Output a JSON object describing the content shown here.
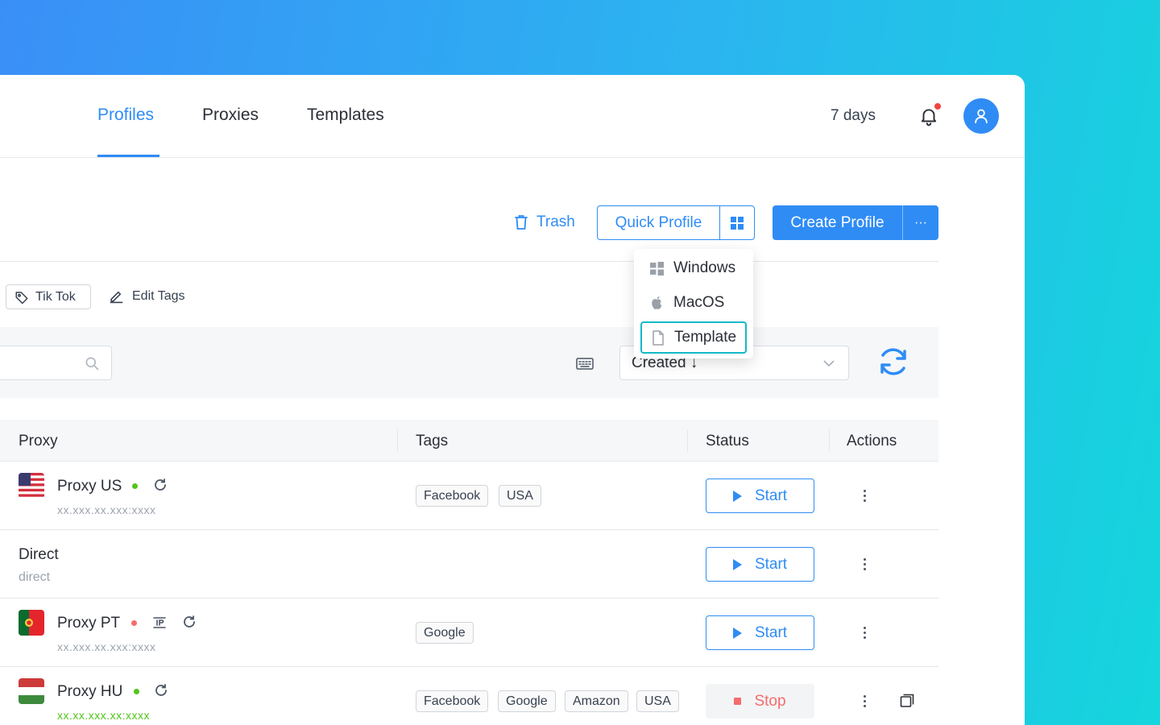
{
  "nav": {
    "tabs": [
      {
        "label": "Profiles"
      },
      {
        "label": "Proxies"
      },
      {
        "label": "Templates"
      }
    ],
    "trial_days": "7 days",
    "has_notification": true
  },
  "toolbar": {
    "trash_label": "Trash",
    "quick_profile_label": "Quick Profile",
    "quick_os_icon": "windows-icon",
    "create_profile_label": "Create Profile",
    "more_label": "···"
  },
  "quick_menu": {
    "items": [
      {
        "label": "Windows",
        "icon": "windows-icon"
      },
      {
        "label": "MacOS",
        "icon": "apple-icon"
      },
      {
        "label": "Template",
        "icon": "document-icon"
      }
    ],
    "focused_index": 2
  },
  "tags_bar": {
    "tag_label": "Tik Tok",
    "edit_tags_label": "Edit Tags"
  },
  "filter": {
    "search_placeholder": "",
    "sort_label": "Created ↓"
  },
  "table": {
    "headers": [
      "Proxy",
      "Tags",
      "Status",
      "Actions"
    ],
    "rows": [
      {
        "name": "Proxy US",
        "address": "xx.xxx.xx.xxx:xxxx",
        "flag": "US",
        "status_dot": "green",
        "tags": [
          "Facebook",
          "USA"
        ],
        "action": "Start"
      },
      {
        "name": "Direct",
        "address": "direct",
        "flag": "",
        "status_dot": "",
        "tags": [],
        "action": "Start"
      },
      {
        "name": "Proxy PT",
        "address": "xx.xxx.xx.xxx:xxxx",
        "flag": "PT",
        "status_dot": "red",
        "tags": [
          "Google"
        ],
        "action": "Start"
      },
      {
        "name": "Proxy HU",
        "address": "xx.xx.xxx.xx:xxxx",
        "flag": "HU",
        "status_dot": "green",
        "tags": [
          "Facebook",
          "Google",
          "Amazon",
          "USA"
        ],
        "action": "Stop"
      }
    ]
  },
  "colors": {
    "primary": "#2f8cf5",
    "accent_focus": "#14b8c7",
    "status_green": "#52c41a",
    "status_red": "#f56c6c"
  }
}
